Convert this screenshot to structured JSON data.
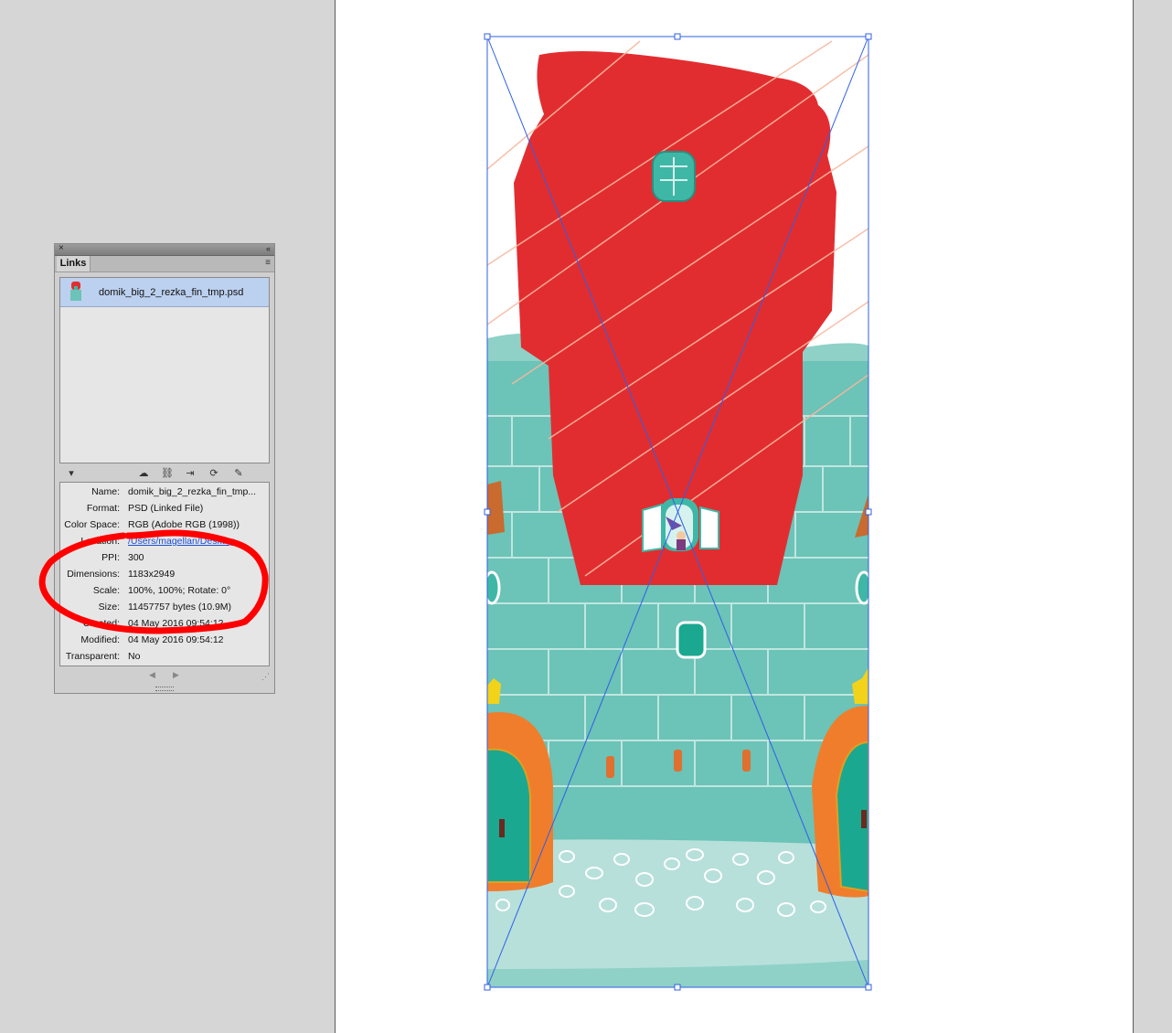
{
  "panel": {
    "tab_label": "Links",
    "close_glyph": "×",
    "collapse_glyph": "«",
    "menu_glyph": "≡",
    "selected_link": "domik_big_2_rezka_fin_tmp.psd",
    "info": [
      {
        "label": "Name:",
        "value": "domik_big_2_rezka_fin_tmp..."
      },
      {
        "label": "Format:",
        "value": "PSD (Linked File)"
      },
      {
        "label": "Color Space:",
        "value": "RGB (Adobe RGB (1998))"
      },
      {
        "label": "Location:",
        "value": "/Users/magellan/Desktop"
      },
      {
        "label": "PPI:",
        "value": "300"
      },
      {
        "label": "Dimensions:",
        "value": "1183x2949"
      },
      {
        "label": "Scale:",
        "value": "100%, 100%; Rotate: 0°"
      },
      {
        "label": "Size:",
        "value": "11457757 bytes (10.9M)"
      },
      {
        "label": "Created:",
        "value": "04 May 2016 09:54:12"
      },
      {
        "label": "Modified:",
        "value": "04 May 2016 09:54:12"
      },
      {
        "label": "Transparent:",
        "value": "No"
      }
    ],
    "toolbar_icons": [
      "collapse-triangle-icon",
      "cloud-icon",
      "relink-icon",
      "goto-link-icon",
      "update-link-icon",
      "edit-original-icon"
    ]
  },
  "colors": {
    "roof_red": "#e22d30",
    "wall_teal": "#6cc3b7",
    "ground": "#b7e0db",
    "door_orange": "#f07d2c",
    "selection_blue": "#2f5fe6",
    "annotation_red": "#ff0000"
  }
}
